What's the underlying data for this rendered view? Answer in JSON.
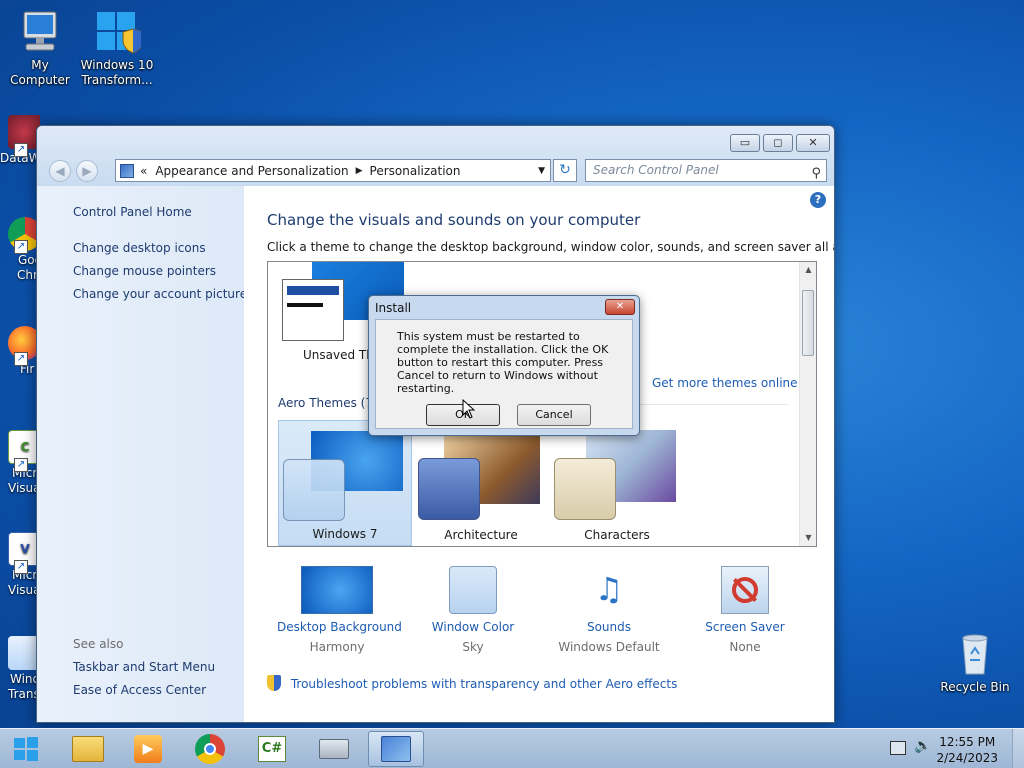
{
  "desktop": {
    "icons": [
      {
        "label_line1": "My Computer",
        "label_line2": "",
        "icon": "computer-icon"
      },
      {
        "label_line1": "Windows 10",
        "label_line2": "Transform...",
        "icon": "windows-shield-icon"
      },
      {
        "label": "Recycle Bin",
        "icon": "recycle-bin-icon"
      }
    ],
    "partial_labels": [
      "DataW",
      "Goo",
      "Chr",
      "Fir",
      "Micr",
      "Visua",
      "Micr",
      "Visua",
      "Wind",
      "Trans"
    ]
  },
  "window": {
    "address": {
      "root": "«",
      "crumb1": "Appearance and Personalization",
      "crumb2": "Personalization"
    },
    "search_placeholder": "Search Control Panel",
    "left": {
      "home": "Control Panel Home",
      "links": [
        "Change desktop icons",
        "Change mouse pointers",
        "Change your account picture"
      ],
      "see_also": "See also",
      "see_links": [
        "Taskbar and Start Menu",
        "Ease of Access Center"
      ]
    },
    "heading": "Change the visuals and sounds on your computer",
    "subheading": "Click a theme to change the desktop background, window color, sounds, and screen saver all at once.",
    "my_themes": [
      {
        "label": "Unsaved The"
      }
    ],
    "get_more": "Get more themes online",
    "aero_header": "Aero Themes (7)",
    "aero_themes": [
      {
        "label": "Windows 7"
      },
      {
        "label": "Architecture"
      },
      {
        "label": "Characters"
      }
    ],
    "tools": [
      {
        "label": "Desktop Background",
        "value": "Harmony"
      },
      {
        "label": "Window Color",
        "value": "Sky"
      },
      {
        "label": "Sounds",
        "value": "Windows Default"
      },
      {
        "label": "Screen Saver",
        "value": "None"
      }
    ],
    "troubleshoot": "Troubleshoot problems with transparency and other Aero effects"
  },
  "dialog": {
    "title": "Install",
    "message": "This system must be restarted to complete the installation. Click the OK button to restart this computer. Press Cancel to return to Windows without restarting.",
    "ok": "OK",
    "cancel": "Cancel"
  },
  "taskbar": {
    "items": [
      "explorer-icon",
      "media-player-icon",
      "chrome-icon",
      "csharp-icon",
      "keyboard-icon",
      "control-panel-icon"
    ],
    "time": "12:55 PM",
    "date": "2/24/2023"
  }
}
